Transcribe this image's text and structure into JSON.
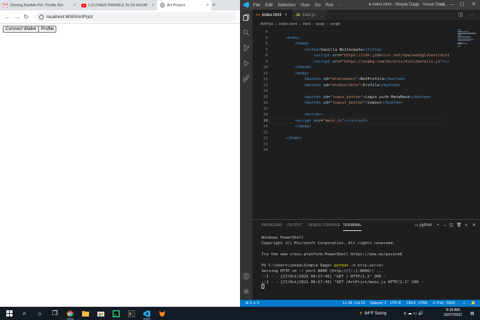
{
  "browser": {
    "tabs": [
      {
        "title": "Cloning Rarible Pt1: Profile Bin",
        "icon": "gmail-icon"
      },
      {
        "title": "I CLONED RARIBLE IN 24 HOUR",
        "icon": "youtube-icon"
      },
      {
        "title": "Art Project",
        "icon": "globe-icon"
      }
    ],
    "tab_close": "×",
    "new_tab": "+",
    "back": "←",
    "forward": "→",
    "reload": "↻",
    "info_glyph": "i",
    "url": "localhost:8000/ArtPrjct/",
    "page_buttons": [
      "Connect Wallet",
      "Profile"
    ]
  },
  "vscode": {
    "menu": [
      "File",
      "Edit",
      "Selection",
      "View",
      "Go",
      "Run",
      "···"
    ],
    "window_title": "● index.html - Simple Dapp - Visual Studi...",
    "window_controls": [
      "▭",
      "—",
      "▢",
      "✕"
    ],
    "editor_tabs": [
      {
        "label": "index.html",
        "badge": "<>",
        "badge_color": "#e37933",
        "close": "×"
      },
      {
        "label": "main.js",
        "badge": "JS",
        "badge_color": "#cbcb41",
        "close": ""
      }
    ],
    "editor_actions": [
      "◫",
      "···"
    ],
    "breadcrumb": [
      "ArtPrjct",
      "index.html",
      "html",
      "body",
      "script"
    ],
    "breadcrumb_sep": "›",
    "code_lines": [
      {
        "n": "4",
        "html": ""
      },
      {
        "n": "5",
        "html": "    <span class=\"tg\">&lt;html&gt;</span>"
      },
      {
        "n": "6",
        "html": "        <span class=\"tg\">&lt;head&gt;</span>"
      },
      {
        "n": "7",
        "html": "            <span class=\"tg\">&lt;title&gt;</span><span class=\"tx\">Vanilla Boilerpate</span><span class=\"tg\">&lt;/title&gt;</span>"
      },
      {
        "n": "8",
        "html": "                <span class=\"tg\">&lt;script</span> <span class=\"at\">src</span>=<span class=\"st\">\"https://cdn.jsdelivr.net/npm/web3@latest/dist</span>"
      },
      {
        "n": "9",
        "html": "                <span class=\"tg\">&lt;script</span> <span class=\"at\">src</span>=<span class=\"st\">\"https://unpkg.com/moralis/dist/moralis.js\"</span><span class=\"tg\">&gt;&lt;/</span>"
      },
      {
        "n": "10",
        "html": "        <span class=\"tg\">&lt;/head&gt;</span>"
      },
      {
        "n": "11",
        "html": "        <span class=\"tg\">&lt;body&gt;</span>"
      },
      {
        "n": "12",
        "html": "            <span class=\"tg\">&lt;button</span> <span class=\"at\">id</span>=<span class=\"st\">\"btnConnect\"</span><span class=\"tg\">&gt;</span><span class=\"tx\">NotProfile</span><span class=\"tg\">&lt;/button&gt;</span>"
      },
      {
        "n": "13",
        "html": "            <span class=\"tg\">&lt;button</span> <span class=\"at\">id</span>=<span class=\"st\">\"btnUserInfo\"</span><span class=\"tg\">&gt;</span><span class=\"tx\">Profile</span><span class=\"tg\">&lt;/button&gt;</span>"
      },
      {
        "n": "14",
        "html": ""
      },
      {
        "n": "15",
        "html": "            <span class=\"tg\">&lt;button</span> <span class=\"at\">id</span>=<span class=\"st\">\"login_button\"</span><span class=\"tg\">&gt;</span><span class=\"tx\">Login with MetaMask</span><span class=\"tg\">&lt;/button&gt;</span>"
      },
      {
        "n": "16",
        "html": "            <span class=\"tg\">&lt;button</span> <span class=\"at\">id</span>=<span class=\"st\">\"logout_button\"</span><span class=\"tg\">&gt;</span><span class=\"tx\">Logout</span><span class=\"tg\">&lt;/button&gt;</span>"
      },
      {
        "n": "17",
        "html": ""
      },
      {
        "n": "18",
        "html": "            <span class=\"tg\">&lt;br&gt;&lt;br&gt;</span>"
      },
      {
        "n": "19",
        "html": "        <span class=\"tg\">&lt;script</span> <span class=\"at\">src</span>=<span class=\"st\">\"main.js\"</span><span class=\"tg\">&gt;&lt;/script&gt;</span>"
      },
      {
        "n": "20",
        "html": "        <span class=\"tg\">&lt;/body&gt;</span>"
      },
      {
        "n": "21",
        "html": ""
      },
      {
        "n": "22",
        "html": "    <span class=\"tg\">&lt;/html&gt;</span>"
      },
      {
        "n": "23",
        "html": ""
      },
      {
        "n": "24",
        "html": ""
      }
    ],
    "current_line_index": 15,
    "panel_tabs": [
      "PROBLEMS",
      "OUTPUT",
      "DEBUG CONSOLE",
      "TERMINAL"
    ],
    "active_panel_tab": "TERMINAL",
    "terminal_shell": "python",
    "panel_actions": [
      "+",
      "⌄",
      "◫",
      "🗑",
      "∧",
      "✕"
    ],
    "terminal_lines": [
      "Windows PowerShell",
      "Copyright (C) Microsoft Corporation. All rights reserved.",
      "",
      "Try the new cross-platform PowerShell https://aka.ms/pscore6",
      "",
      "PS C:\\Users\\jonka\\Simple Dapp> ",
      "Serving HTTP on :: port 8000 (http://[::]:8000/) ...",
      "::1 - - [27/Oct/2021 09:17:45] \"GET / HTTP/1.1\" 200 -",
      "::1 - - [27/Oct/2021 09:17:49] \"GET /ArtPrjct/main.js HTTP/1.1\" 200 -"
    ],
    "terminal_cmd": "python",
    "terminal_args": " -m http.server",
    "status": {
      "errors": "⊗ 0 ⚠ 0",
      "position": "Ln 18, Col 23",
      "spaces": "Spaces: 2",
      "encoding": "UTF-8",
      "eol": "CRLF",
      "language": "HTML",
      "port": "⊙ Port : 5500",
      "feedback": "♫",
      "bell": "🔔"
    }
  },
  "taskbar": {
    "icons": [
      {
        "name": "start-icon",
        "glyph": "⊞"
      },
      {
        "name": "search-icon",
        "glyph": "⌕"
      },
      {
        "name": "cortana-icon",
        "glyph": "○"
      },
      {
        "name": "task-view-icon",
        "glyph": "❐"
      },
      {
        "name": "chrome-icon",
        "glyph": "◉"
      },
      {
        "name": "file-explorer-icon",
        "glyph": "▰"
      },
      {
        "name": "store-icon",
        "glyph": "⛋"
      },
      {
        "name": "pycharm-icon",
        "glyph": "▦"
      },
      {
        "name": "terminal-icon",
        "glyph": "▣"
      },
      {
        "name": "vscode-icon",
        "glyph": "◆"
      },
      {
        "name": "metamask-icon",
        "glyph": "✦"
      }
    ],
    "weather": "64°F  Sunny",
    "tray_glyphs": "∧  ☁  ▭  🔊",
    "time": "9:18 AM",
    "date": "10/27/2021",
    "notification": "▤"
  }
}
